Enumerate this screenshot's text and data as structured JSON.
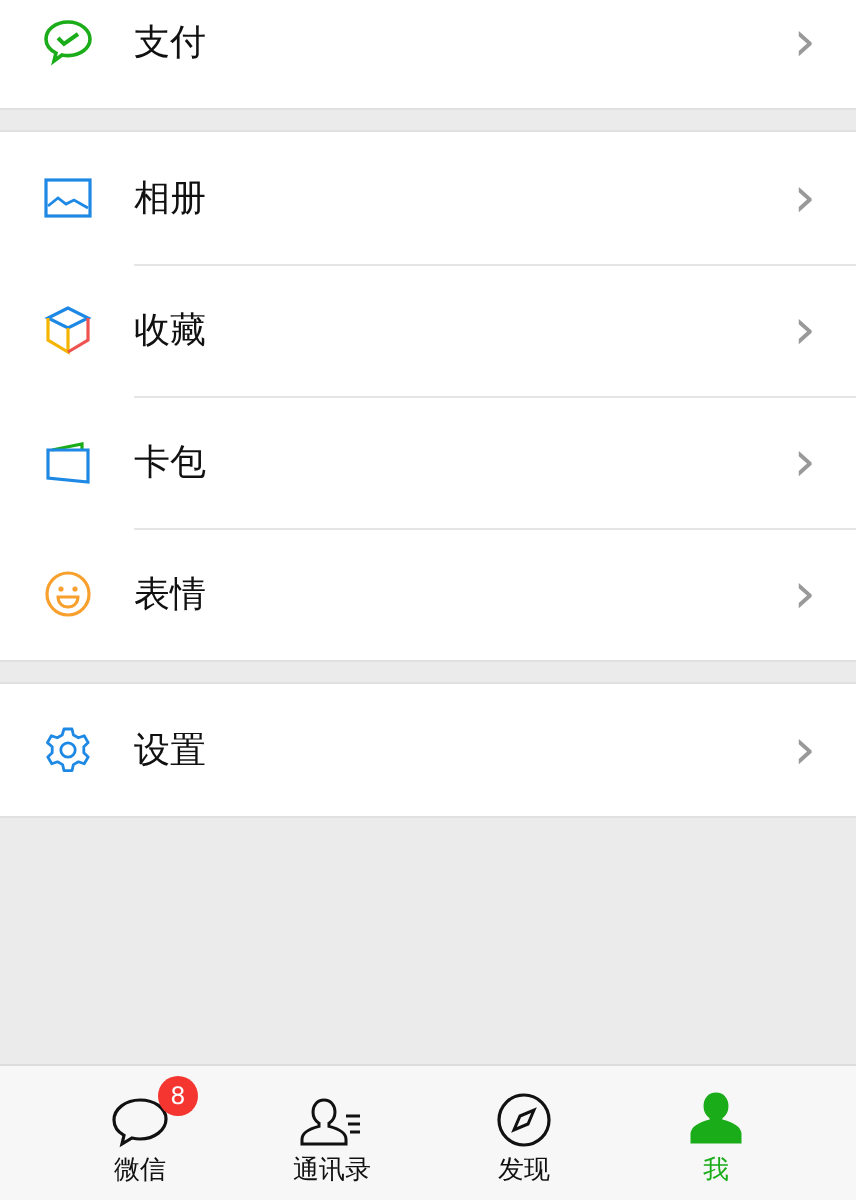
{
  "menu_groups": [
    {
      "items": [
        {
          "label": "支付",
          "chevron": "›"
        }
      ]
    },
    {
      "items": [
        {
          "label": "相册",
          "chevron": "›"
        },
        {
          "label": "收藏",
          "chevron": "›"
        },
        {
          "label": "卡包",
          "chevron": "›"
        },
        {
          "label": "表情",
          "chevron": "›"
        }
      ]
    },
    {
      "items": [
        {
          "label": "设置",
          "chevron": "›"
        }
      ]
    }
  ],
  "tab_bar": [
    {
      "label": "微信",
      "selected": false,
      "badge": "8"
    },
    {
      "label": "通讯录",
      "selected": false
    },
    {
      "label": "发现",
      "selected": false
    },
    {
      "label": "我",
      "selected": true
    }
  ]
}
